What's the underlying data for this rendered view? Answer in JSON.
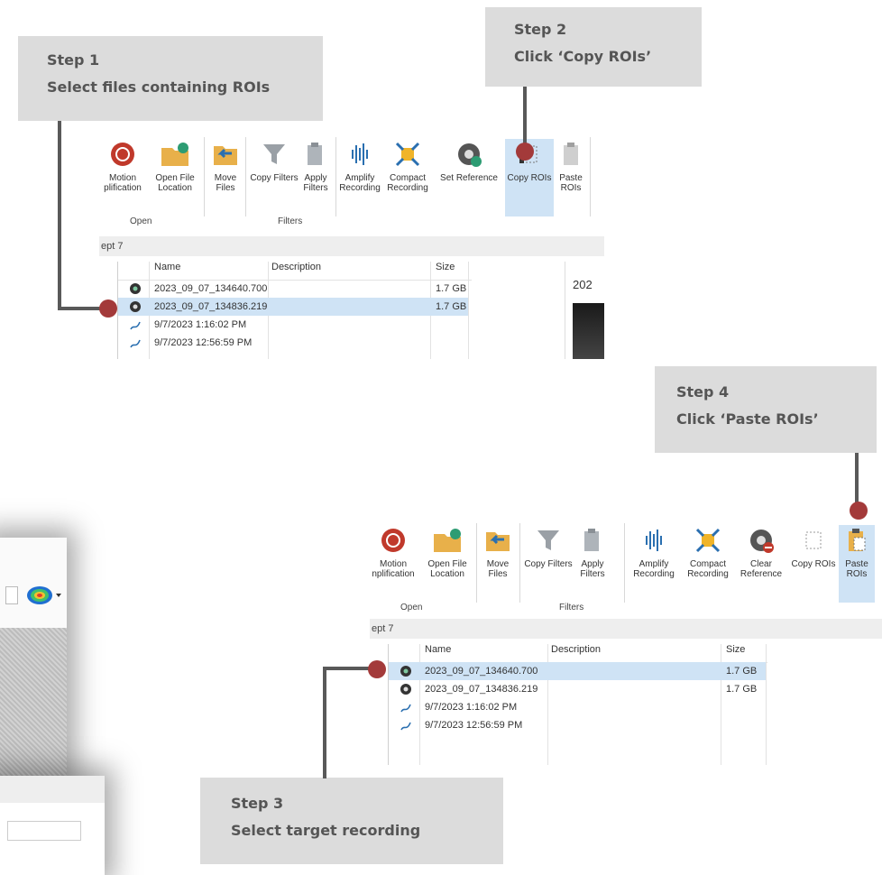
{
  "callouts": {
    "step1": {
      "title": "Step 1",
      "text": "Select files containing ROIs"
    },
    "step2": {
      "title": "Step 2",
      "text": "Click ‘Copy ROIs’"
    },
    "step3": {
      "title": "Step 3",
      "text": "Select target recording"
    },
    "step4": {
      "title": "Step 4",
      "text": "Click ‘Paste ROIs’"
    }
  },
  "ribbon_top": {
    "buttons": [
      {
        "l1": "Motion",
        "l2": "plification",
        "icon": "motion-amplification-icon"
      },
      {
        "l1": "Open File",
        "l2": "Location",
        "icon": "folder-open-icon"
      },
      {
        "l1": "Move",
        "l2": "Files",
        "icon": "move-files-icon"
      },
      {
        "l1": "Copy Filters",
        "l2": "",
        "icon": "filter-icon"
      },
      {
        "l1": "Apply",
        "l2": "Filters",
        "icon": "apply-filter-icon"
      },
      {
        "l1": "Amplify",
        "l2": "Recording",
        "icon": "waveform-icon"
      },
      {
        "l1": "Compact",
        "l2": "Recording",
        "icon": "compact-icon"
      },
      {
        "l1": "Set Reference",
        "l2": "",
        "icon": "set-reference-icon"
      },
      {
        "l1": "Copy ROIs",
        "l2": "",
        "icon": "copy-rois-icon"
      },
      {
        "l1": "Paste",
        "l2": "ROIs",
        "icon": "paste-rois-icon"
      }
    ],
    "groups": {
      "open": "Open",
      "filters": "Filters"
    },
    "path": "ept 7",
    "headers": {
      "name": "Name",
      "description": "Description",
      "size": "Size"
    },
    "rows": [
      {
        "name": "2023_09_07_134640.700",
        "size": "1.7 GB"
      },
      {
        "name": "2023_09_07_134836.219",
        "size": "1.7 GB"
      },
      {
        "name": "9/7/2023 1:16:02 PM",
        "size": ""
      },
      {
        "name": "9/7/2023 12:56:59 PM",
        "size": ""
      }
    ],
    "preview_text": "202"
  },
  "ribbon_bottom": {
    "buttons": [
      {
        "l1": "Motion",
        "l2": "nplification",
        "icon": "motion-amplification-icon"
      },
      {
        "l1": "Open File",
        "l2": "Location",
        "icon": "folder-open-icon"
      },
      {
        "l1": "Move",
        "l2": "Files",
        "icon": "move-files-icon"
      },
      {
        "l1": "Copy Filters",
        "l2": "",
        "icon": "filter-icon"
      },
      {
        "l1": "Apply",
        "l2": "Filters",
        "icon": "apply-filter-icon"
      },
      {
        "l1": "Amplify",
        "l2": "Recording",
        "icon": "waveform-icon"
      },
      {
        "l1": "Compact",
        "l2": "Recording",
        "icon": "compact-icon"
      },
      {
        "l1": "Clear",
        "l2": "Reference",
        "icon": "clear-reference-icon"
      },
      {
        "l1": "Copy ROIs",
        "l2": "",
        "icon": "copy-rois-icon"
      },
      {
        "l1": "Paste",
        "l2": "ROIs",
        "icon": "paste-rois-icon"
      }
    ],
    "groups": {
      "open": "Open",
      "filters": "Filters"
    },
    "path": "ept 7",
    "headers": {
      "name": "Name",
      "description": "Description",
      "size": "Size"
    },
    "rows": [
      {
        "name": "2023_09_07_134640.700",
        "size": "1.7 GB"
      },
      {
        "name": "2023_09_07_134836.219",
        "size": "1.7 GB"
      },
      {
        "name": "9/7/2023 1:16:02 PM",
        "size": ""
      },
      {
        "name": "9/7/2023 12:56:59 PM",
        "size": ""
      }
    ]
  },
  "colors": {
    "accent_dot": "#a33a3a",
    "callout_bg": "#dcdcdc",
    "selection": "#cfe3f5",
    "connector": "#595959"
  }
}
